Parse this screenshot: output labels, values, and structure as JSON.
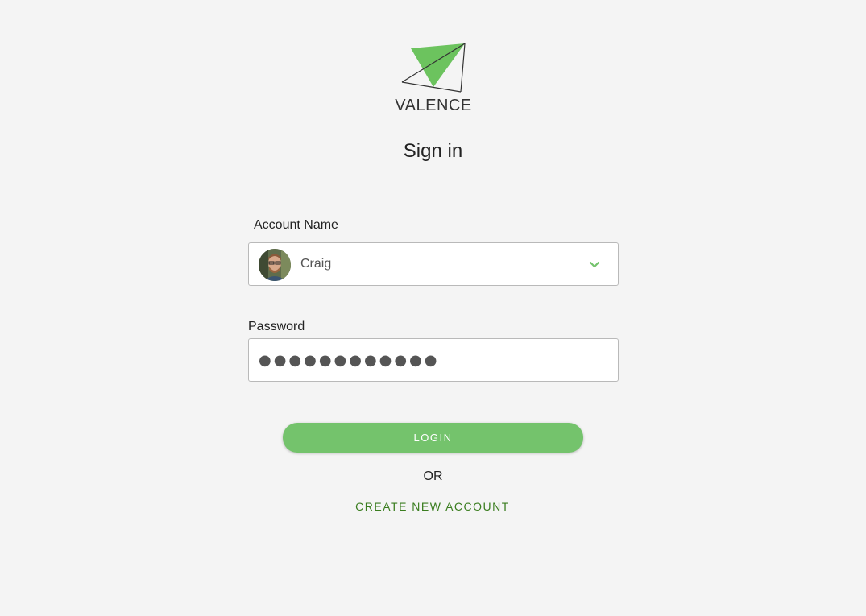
{
  "brand": {
    "name": "VALENCE",
    "accent_color": "#74c36c",
    "link_color": "#3a7d1f"
  },
  "page_title": "Sign in",
  "account": {
    "label": "Account Name",
    "selected_value": "Craig",
    "avatar_icon": "user-avatar",
    "dropdown_icon": "chevron-down-icon"
  },
  "password": {
    "label": "Password",
    "masked_value": "●●●●●●●●●●●●"
  },
  "actions": {
    "login_label": "LOGIN",
    "or_label": "OR",
    "create_account_label": "CREATE NEW ACCOUNT"
  }
}
